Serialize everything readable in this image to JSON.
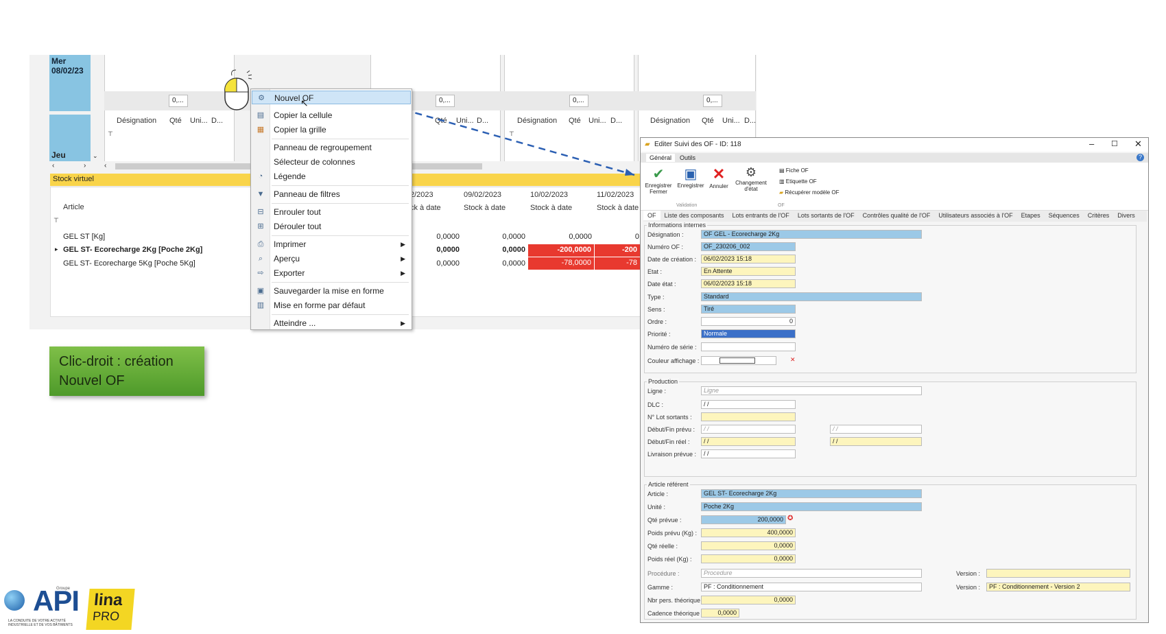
{
  "planning": {
    "day1_name": "Mer",
    "day1_date": "08/02/23",
    "day2_name": "Jeu",
    "counters": [
      "0,...",
      "0,...",
      "0,...",
      "0,..."
    ],
    "grid_headers": [
      "Désignation",
      "Qté",
      "Uni...",
      "D..."
    ],
    "stock_bar": "Stock virtuel",
    "article_header": "Article",
    "date_headers": [
      "2/2023",
      "09/02/2023",
      "10/02/2023",
      "11/02/2023"
    ],
    "sub_headers": [
      "ck à date",
      "Stock à date",
      "Stock à date",
      "Stock à date"
    ],
    "rows": [
      {
        "article": "GEL ST [Kg]",
        "values": [
          "0,0000",
          "0,0000",
          "0,0000",
          "0"
        ]
      },
      {
        "article": "GEL ST- Ecorecharge 2Kg [Poche 2Kg]",
        "values": [
          "0,0000",
          "0,0000",
          "-200,0000",
          "-200"
        ]
      },
      {
        "article": "GEL ST- Ecorecharge 5Kg [Poche 5Kg]",
        "values": [
          "0,0000",
          "0,0000",
          "-78,0000",
          "-78"
        ]
      }
    ]
  },
  "context_menu": {
    "items": [
      {
        "label": "Nouvel OF",
        "icon": "new-of-icon"
      },
      {
        "label": "Copier la cellule",
        "icon": "copy-cell-icon"
      },
      {
        "label": "Copier la grille",
        "icon": "copy-grid-icon"
      },
      {
        "label": "Panneau de regroupement",
        "icon": ""
      },
      {
        "label": "Sélecteur de colonnes",
        "icon": ""
      },
      {
        "label": "Légende",
        "icon": "palette-icon"
      },
      {
        "label": "Panneau de filtres",
        "icon": "filter-icon"
      },
      {
        "label": "Enrouler tout",
        "icon": "collapse-icon"
      },
      {
        "label": "Dérouler tout",
        "icon": "expand-icon"
      },
      {
        "label": "Imprimer",
        "icon": "printer-icon"
      },
      {
        "label": "Aperçu",
        "icon": "preview-icon"
      },
      {
        "label": "Exporter",
        "icon": "export-icon"
      },
      {
        "label": "Sauvegarder la mise en forme",
        "icon": "save-icon"
      },
      {
        "label": "Mise en forme par défaut",
        "icon": "layout-icon"
      },
      {
        "label": "Atteindre ...",
        "icon": ""
      }
    ]
  },
  "callout": {
    "line1": "Clic-droit : création",
    "line2": "Nouvel OF"
  },
  "logos": {
    "api": "API",
    "api_tag": "LA CONDUITE DE VOTRE ACTIVITÉ INDUSTRIELLE ET DE VOS BÂTIMENTS",
    "groupe": "Groupe",
    "lina": "lina",
    "pro": "PRO"
  },
  "dialog": {
    "title": "Editer Suivi des OF - ID: 118",
    "ribbon_tabs": [
      "Général",
      "Outils"
    ],
    "ribbon": {
      "save_close": "Enregistrer Fermer",
      "save": "Enregistrer",
      "cancel": "Annuler",
      "change_state": "Changement d'état",
      "fiche_of": "Fiche OF",
      "etiquette_of": "Etiquette OF",
      "recup_modele": "Récupérer modèle OF",
      "group_validation": "Validation",
      "group_of": "OF"
    },
    "tabs": [
      "OF",
      "Liste des composants",
      "Lots entrants de l'OF",
      "Lots sortants de l'OF",
      "Contrôles qualité de l'OF",
      "Utilisateurs associés à l'OF",
      "Etapes",
      "Séquences",
      "Critères",
      "Divers"
    ],
    "info": {
      "title": "Informations internes",
      "designation_label": "Désignation :",
      "designation": "OF GEL - Ecorecharge 2Kg",
      "numero_label": "Numéro OF :",
      "numero": "OF_230206_002",
      "date_creation_label": "Date de création :",
      "date_creation": "06/02/2023 15:18",
      "etat_label": "Etat :",
      "etat": "En Attente",
      "date_etat_label": "Date état :",
      "date_etat": "06/02/2023 15:18",
      "type_label": "Type :",
      "type": "Standard",
      "sens_label": "Sens :",
      "sens": "Tiré",
      "ordre_label": "Ordre :",
      "ordre": "0",
      "priorite_label": "Priorité :",
      "priorite": "Normale",
      "serie_label": "Numéro de série :",
      "couleur_label": "Couleur affichage :"
    },
    "production": {
      "title": "Production",
      "ligne_label": "Ligne :",
      "ligne": "Ligne",
      "dlc_label": "DLC :",
      "dlc": "/ /",
      "lot_label": "N° Lot sortants :",
      "debut_prevu_label": "Début/Fin prévu :",
      "debut_prevu": "/ /",
      "debut_reel_label": "Début/Fin réel :",
      "debut_reel": "/ /",
      "livraison_label": "Livraison prévue :",
      "livraison": "/ /"
    },
    "article": {
      "title": "Article référent",
      "article_label": "Article :",
      "article": "GEL ST- Ecorecharge 2Kg",
      "unite_label": "Unité :",
      "unite": "Poche 2Kg",
      "qte_prevue_label": "Qté prévue :",
      "qte_prevue": "200,0000",
      "poids_prevu_label": "Poids prévu (Kg) :",
      "poids_prevu": "400,0000",
      "qte_reelle_label": "Qté réelle :",
      "qte_reelle": "0,0000",
      "poids_reel_label": "Poids réel (Kg) :",
      "poids_reel": "0,0000",
      "procedure_label": "Procédure :",
      "procedure": "Procedure",
      "gamme_label": "Gamme :",
      "gamme": "PF : Conditionnement",
      "version_label": "Version :",
      "version2": "PF : Conditionnement - Version 2",
      "nbr_label": "Nbr pers. théorique :",
      "nbr": "0,0000",
      "cadence_label": "Cadence théorique :",
      "cadence": "0,0000"
    }
  }
}
